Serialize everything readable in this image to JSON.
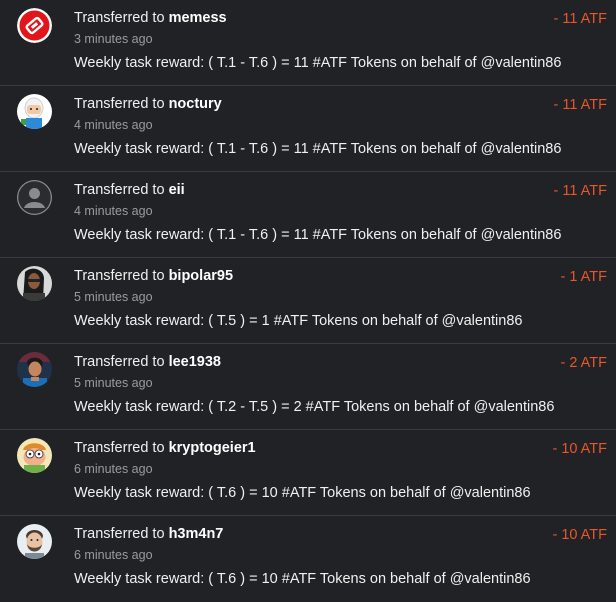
{
  "transfers": [
    {
      "prefix": "Transferred to ",
      "user": "memess",
      "time": "3 minutes ago",
      "memo": "Weekly task reward: ( T.1 - T.6 ) = 11 #ATF Tokens on behalf of @valentin86",
      "amount": "- 11 ATF",
      "avatar": "memess-avatar"
    },
    {
      "prefix": "Transferred to ",
      "user": "noctury",
      "time": "4 minutes ago",
      "memo": "Weekly task reward: ( T.1 - T.6 ) = 11 #ATF Tokens on behalf of @valentin86",
      "amount": "- 11 ATF",
      "avatar": "noctury-avatar"
    },
    {
      "prefix": "Transferred to ",
      "user": "eii",
      "time": "4 minutes ago",
      "memo": "Weekly task reward: ( T.1 - T.6 ) = 11 #ATF Tokens on behalf of @valentin86",
      "amount": "- 11 ATF",
      "avatar": "eii-avatar"
    },
    {
      "prefix": "Transferred to ",
      "user": "bipolar95",
      "time": "5 minutes ago",
      "memo": "Weekly task reward: ( T.5 ) = 1 #ATF Tokens on behalf of @valentin86",
      "amount": "- 1 ATF",
      "avatar": "bipolar95-avatar"
    },
    {
      "prefix": "Transferred to ",
      "user": "lee1938",
      "time": "5 minutes ago",
      "memo": "Weekly task reward: ( T.2 - T.5 ) = 2 #ATF Tokens on behalf of @valentin86",
      "amount": "- 2 ATF",
      "avatar": "lee1938-avatar"
    },
    {
      "prefix": "Transferred to ",
      "user": "kryptogeier1",
      "time": "6 minutes ago",
      "memo": "Weekly task reward: ( T.6 ) = 10 #ATF Tokens on behalf of @valentin86",
      "amount": "- 10 ATF",
      "avatar": "kryptogeier1-avatar"
    },
    {
      "prefix": "Transferred to ",
      "user": "h3m4n7",
      "time": "6 minutes ago",
      "memo": "Weekly task reward: ( T.6 ) = 10 #ATF Tokens on behalf of @valentin86",
      "amount": "- 10 ATF",
      "avatar": "h3m4n7-avatar"
    }
  ],
  "colors": {
    "background": "#212226",
    "amount": "#e8562a",
    "divider": "#3a3b40",
    "muted": "#9a9ba0"
  }
}
